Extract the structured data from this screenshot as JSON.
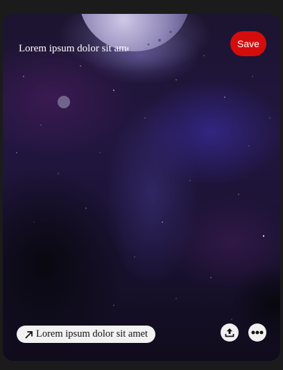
{
  "pin": {
    "title": "Lorem ipsum dolor sit amet",
    "save_label": "Save",
    "link_text": "Lorem ipsum dolor sit amet",
    "image": "purple starry night sky with two planets",
    "icons": {
      "link": "arrow-up-right-icon",
      "share": "share-upload-icon",
      "more": "more-horizontal-icon"
    },
    "colors": {
      "save_button": "#d50c0c",
      "background": "#1b1b1b",
      "pill": "#f2f2f2"
    }
  }
}
